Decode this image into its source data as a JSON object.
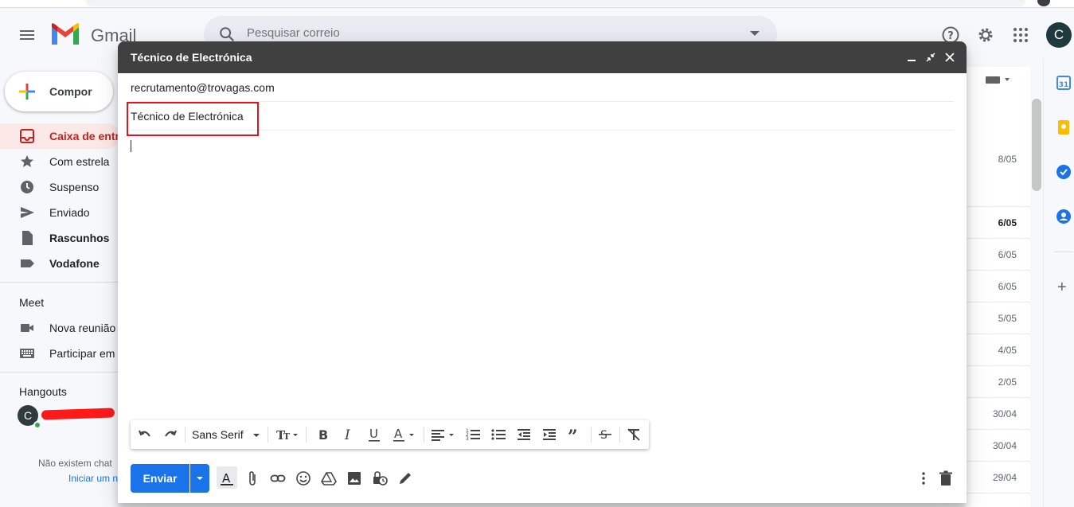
{
  "app": {
    "name": "Gmail"
  },
  "search": {
    "placeholder": "Pesquisar correio"
  },
  "user": {
    "initial": "C"
  },
  "sidebar": {
    "compose_label": "Compor",
    "items": [
      {
        "label": "Caixa de entr",
        "icon": "inbox-icon",
        "active": true
      },
      {
        "label": "Com estrela",
        "icon": "star-icon"
      },
      {
        "label": "Suspenso",
        "icon": "clock-icon"
      },
      {
        "label": "Enviado",
        "icon": "send-icon"
      },
      {
        "label": "Rascunhos",
        "icon": "draft-icon",
        "bold": true
      },
      {
        "label": "Vodafone",
        "icon": "label-icon",
        "bold": true
      }
    ],
    "meet": {
      "title": "Meet",
      "items": [
        {
          "label": "Nova reunião",
          "icon": "video-icon"
        },
        {
          "label": "Participar em",
          "icon": "keyboard-icon"
        }
      ]
    },
    "hangouts": {
      "title": "Hangouts",
      "avatar_initial": "C",
      "no_chats_text": "Não existem chat",
      "start_link": "Iniciar um n"
    }
  },
  "email_list": {
    "dates": [
      {
        "text": "8/05",
        "unread": false
      },
      {
        "text": "6/05",
        "unread": true
      },
      {
        "text": "6/05",
        "unread": false
      },
      {
        "text": "6/05",
        "unread": false
      },
      {
        "text": "5/05",
        "unread": false
      },
      {
        "text": "4/05",
        "unread": false
      },
      {
        "text": "2/05",
        "unread": false
      },
      {
        "text": "30/04",
        "unread": false
      },
      {
        "text": "30/04",
        "unread": false
      },
      {
        "text": "29/04",
        "unread": false
      }
    ]
  },
  "compose": {
    "title": "Técnico de Electrónica",
    "recipient": "recrutamento@trovagas.com",
    "subject": "Técnico de Electrónica",
    "font_name": "Sans Serif",
    "send_label": "Enviar"
  },
  "colors": {
    "send_button": "#1a73e8",
    "compose_header": "#404040",
    "highlight_box": "#e0141f",
    "active_nav": "#c5221f"
  }
}
